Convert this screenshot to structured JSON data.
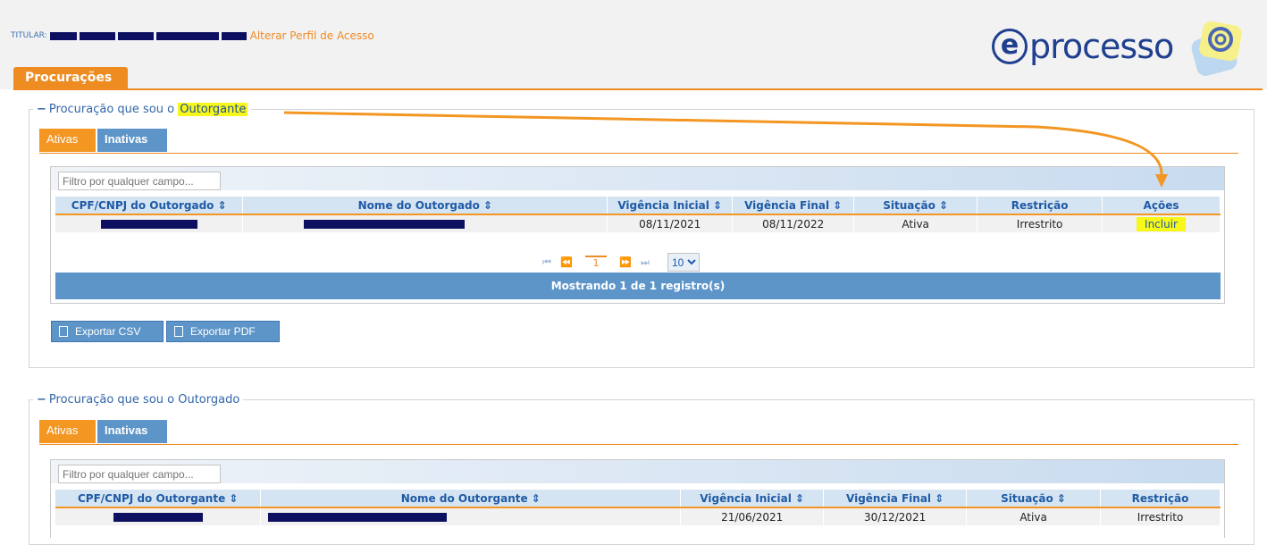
{
  "header": {
    "titular_label": "TITULAR:",
    "alterar_perfil": "Alterar Perfil de Acesso",
    "logo_text": "processo",
    "logo_e": "e"
  },
  "page_tab": "Procurações",
  "section_outorgante": {
    "legend_prefix": "Procuração que sou o ",
    "legend_highlight": "Outorgante",
    "tabs": {
      "ativas": "Ativas",
      "inativas": "Inativas"
    },
    "filter_placeholder": "Filtro por qualquer campo...",
    "columns": [
      "CPF/CNPJ do Outorgado ⇕",
      "Nome do Outorgado ⇕",
      "Vigência Inicial ⇕",
      "Vigência Final ⇕",
      "Situação ⇕",
      "Restrição",
      "Ações"
    ],
    "rows": [
      {
        "vigencia_inicial": "08/11/2021",
        "vigencia_final": "08/11/2022",
        "situacao": "Ativa",
        "restricao": "Irrestrito",
        "acao": "Incluir"
      }
    ],
    "pager": {
      "first": "⏮",
      "prev": "⏪",
      "current": "1",
      "next": "⏩",
      "last": "⏭",
      "page_size": "10"
    },
    "footer": "Mostrando 1 de 1 registro(s)",
    "export_csv": "Exportar CSV",
    "export_pdf": "Exportar PDF"
  },
  "section_outorgado": {
    "legend": "Procuração que sou o Outorgado",
    "tabs": {
      "ativas": "Ativas",
      "inativas": "Inativas"
    },
    "filter_placeholder": "Filtro por qualquer campo...",
    "columns": [
      "CPF/CNPJ do Outorgante ⇕",
      "Nome do Outorgante ⇕",
      "Vigência Inicial ⇕",
      "Vigência Final ⇕",
      "Situação ⇕",
      "Restrição"
    ],
    "rows": [
      {
        "vigencia_inicial": "21/06/2021",
        "vigencia_final": "30/12/2021",
        "situacao": "Ativa",
        "restricao": "Irrestrito"
      }
    ]
  },
  "colors": {
    "orange": "#f39622",
    "blue": "#5e95c9",
    "highlight": "#f7f719",
    "redaction": "#0d1060"
  }
}
